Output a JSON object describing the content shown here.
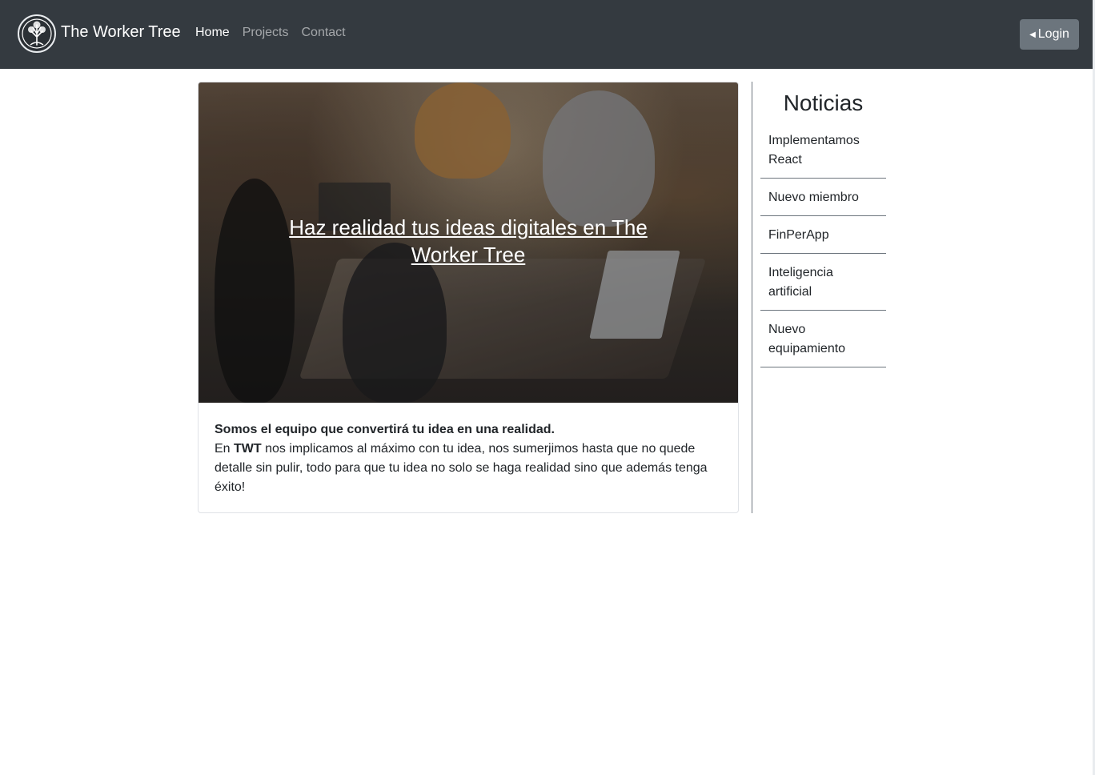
{
  "navbar": {
    "brand": "The Worker Tree",
    "links": [
      {
        "label": "Home"
      },
      {
        "label": "Projects"
      },
      {
        "label": "Contact"
      }
    ],
    "login_label": "Login"
  },
  "hero": {
    "title": "Haz realidad tus ideas digitales en The Worker Tree"
  },
  "intro": {
    "lead": "Somos el equipo que convertirá tu idea en una realidad.",
    "text_before": "En ",
    "brand_short": "TWT",
    "text_after": " nos implicamos al máximo con tu idea, nos sumerjimos hasta que no quede detalle sin pulir, todo para que tu idea no solo se haga realidad sino que además tenga éxito!"
  },
  "sidebar": {
    "title": "Noticias",
    "items": [
      {
        "label": "Implementamos React"
      },
      {
        "label": "Nuevo miembro"
      },
      {
        "label": "FinPerApp"
      },
      {
        "label": "Inteligencia artificial"
      },
      {
        "label": "Nuevo equipamiento"
      }
    ]
  },
  "colors": {
    "navbar": "#343a40",
    "login_button": "#6c757d"
  }
}
